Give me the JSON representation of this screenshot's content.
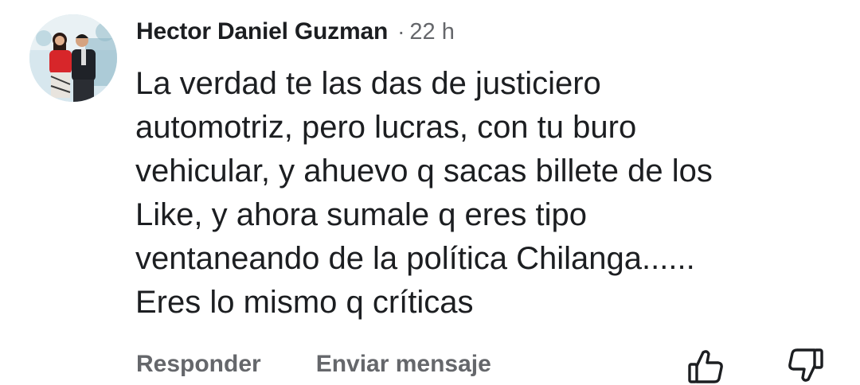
{
  "comment": {
    "author": "Hector Daniel Guzman",
    "separator": "·",
    "time": "22 h",
    "text_lines": [
      "La verdad te las das de justiciero",
      "automotriz, pero lucras, con tu buro",
      "vehicular, y ahuevo q sacas billete de los",
      "Like, y ahora sumale q eres tipo",
      "ventaneando de la política Chilanga......",
      "Eres lo mismo q críticas"
    ]
  },
  "actions": {
    "reply_label": "Responder",
    "message_label": "Enviar mensaje",
    "upvote_icon": "thumbs-up-icon",
    "downvote_icon": "thumbs-down-icon"
  }
}
